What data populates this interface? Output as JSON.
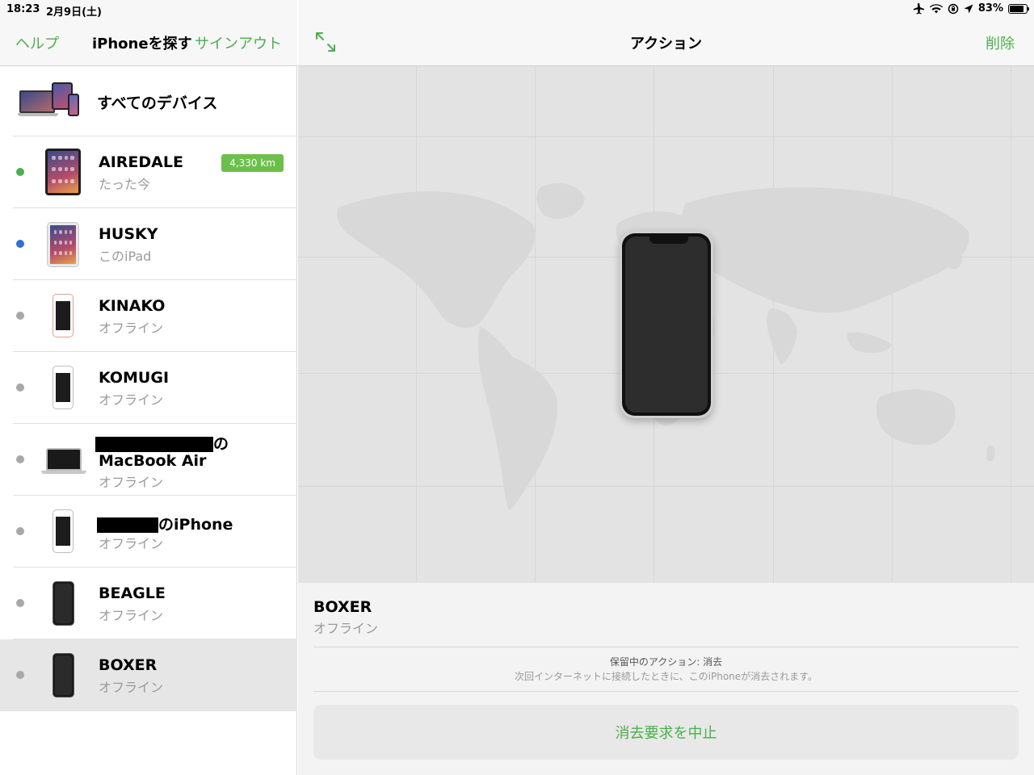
{
  "status_bar": {
    "time": "18:23",
    "date": "2月9日(土)",
    "battery": "83%",
    "battery_level": 0.83,
    "icons": [
      "airplane-icon",
      "wifi-icon",
      "orientation-lock-icon",
      "location-arrow-icon",
      "battery-icon"
    ]
  },
  "sidebar": {
    "help_label": "ヘルプ",
    "title": "iPhoneを探す",
    "signout_label": "サインアウト",
    "all_devices_label": "すべてのデバイス",
    "devices": [
      {
        "name": "AIREDALE",
        "status": "たった今",
        "badge": "4,330 km",
        "dot_color": "#4caf50",
        "kind": "ipad-dark"
      },
      {
        "name": "HUSKY",
        "status": "このiPad",
        "dot_color": "#2f6fd6",
        "kind": "ipad-light"
      },
      {
        "name": "KINAKO",
        "status": "オフライン",
        "dot_color": "#a8a8a8",
        "kind": "iphone-rose"
      },
      {
        "name": "KOMUGI",
        "status": "オフライン",
        "dot_color": "#a8a8a8",
        "kind": "iphone-white"
      },
      {
        "name_line1_suffix": "の",
        "name_line2": "MacBook Air",
        "status": "オフライン",
        "dot_color": "#a8a8a8",
        "kind": "macbook"
      },
      {
        "name_suffix": "のiPhone",
        "status": "オフライン",
        "dot_color": "#a8a8a8",
        "kind": "iphone-white"
      },
      {
        "name": "BEAGLE",
        "status": "オフライン",
        "dot_color": "#a8a8a8",
        "kind": "iphone-x"
      },
      {
        "name": "BOXER",
        "status": "オフライン",
        "dot_color": "#a8a8a8",
        "kind": "iphone-x",
        "selected": true
      }
    ]
  },
  "main": {
    "title": "アクション",
    "delete_label": "削除",
    "selected_name": "BOXER",
    "selected_status": "オフライン",
    "pending_title": "保留中のアクション: 消去",
    "pending_desc": "次回インターネットに接続したときに、このiPhoneが消去されます。",
    "cancel_label": "消去要求を中止"
  },
  "colors": {
    "accent_green": "#4cae4c",
    "badge_green": "#6cc04a",
    "selected_row": "#e6e6e6"
  }
}
